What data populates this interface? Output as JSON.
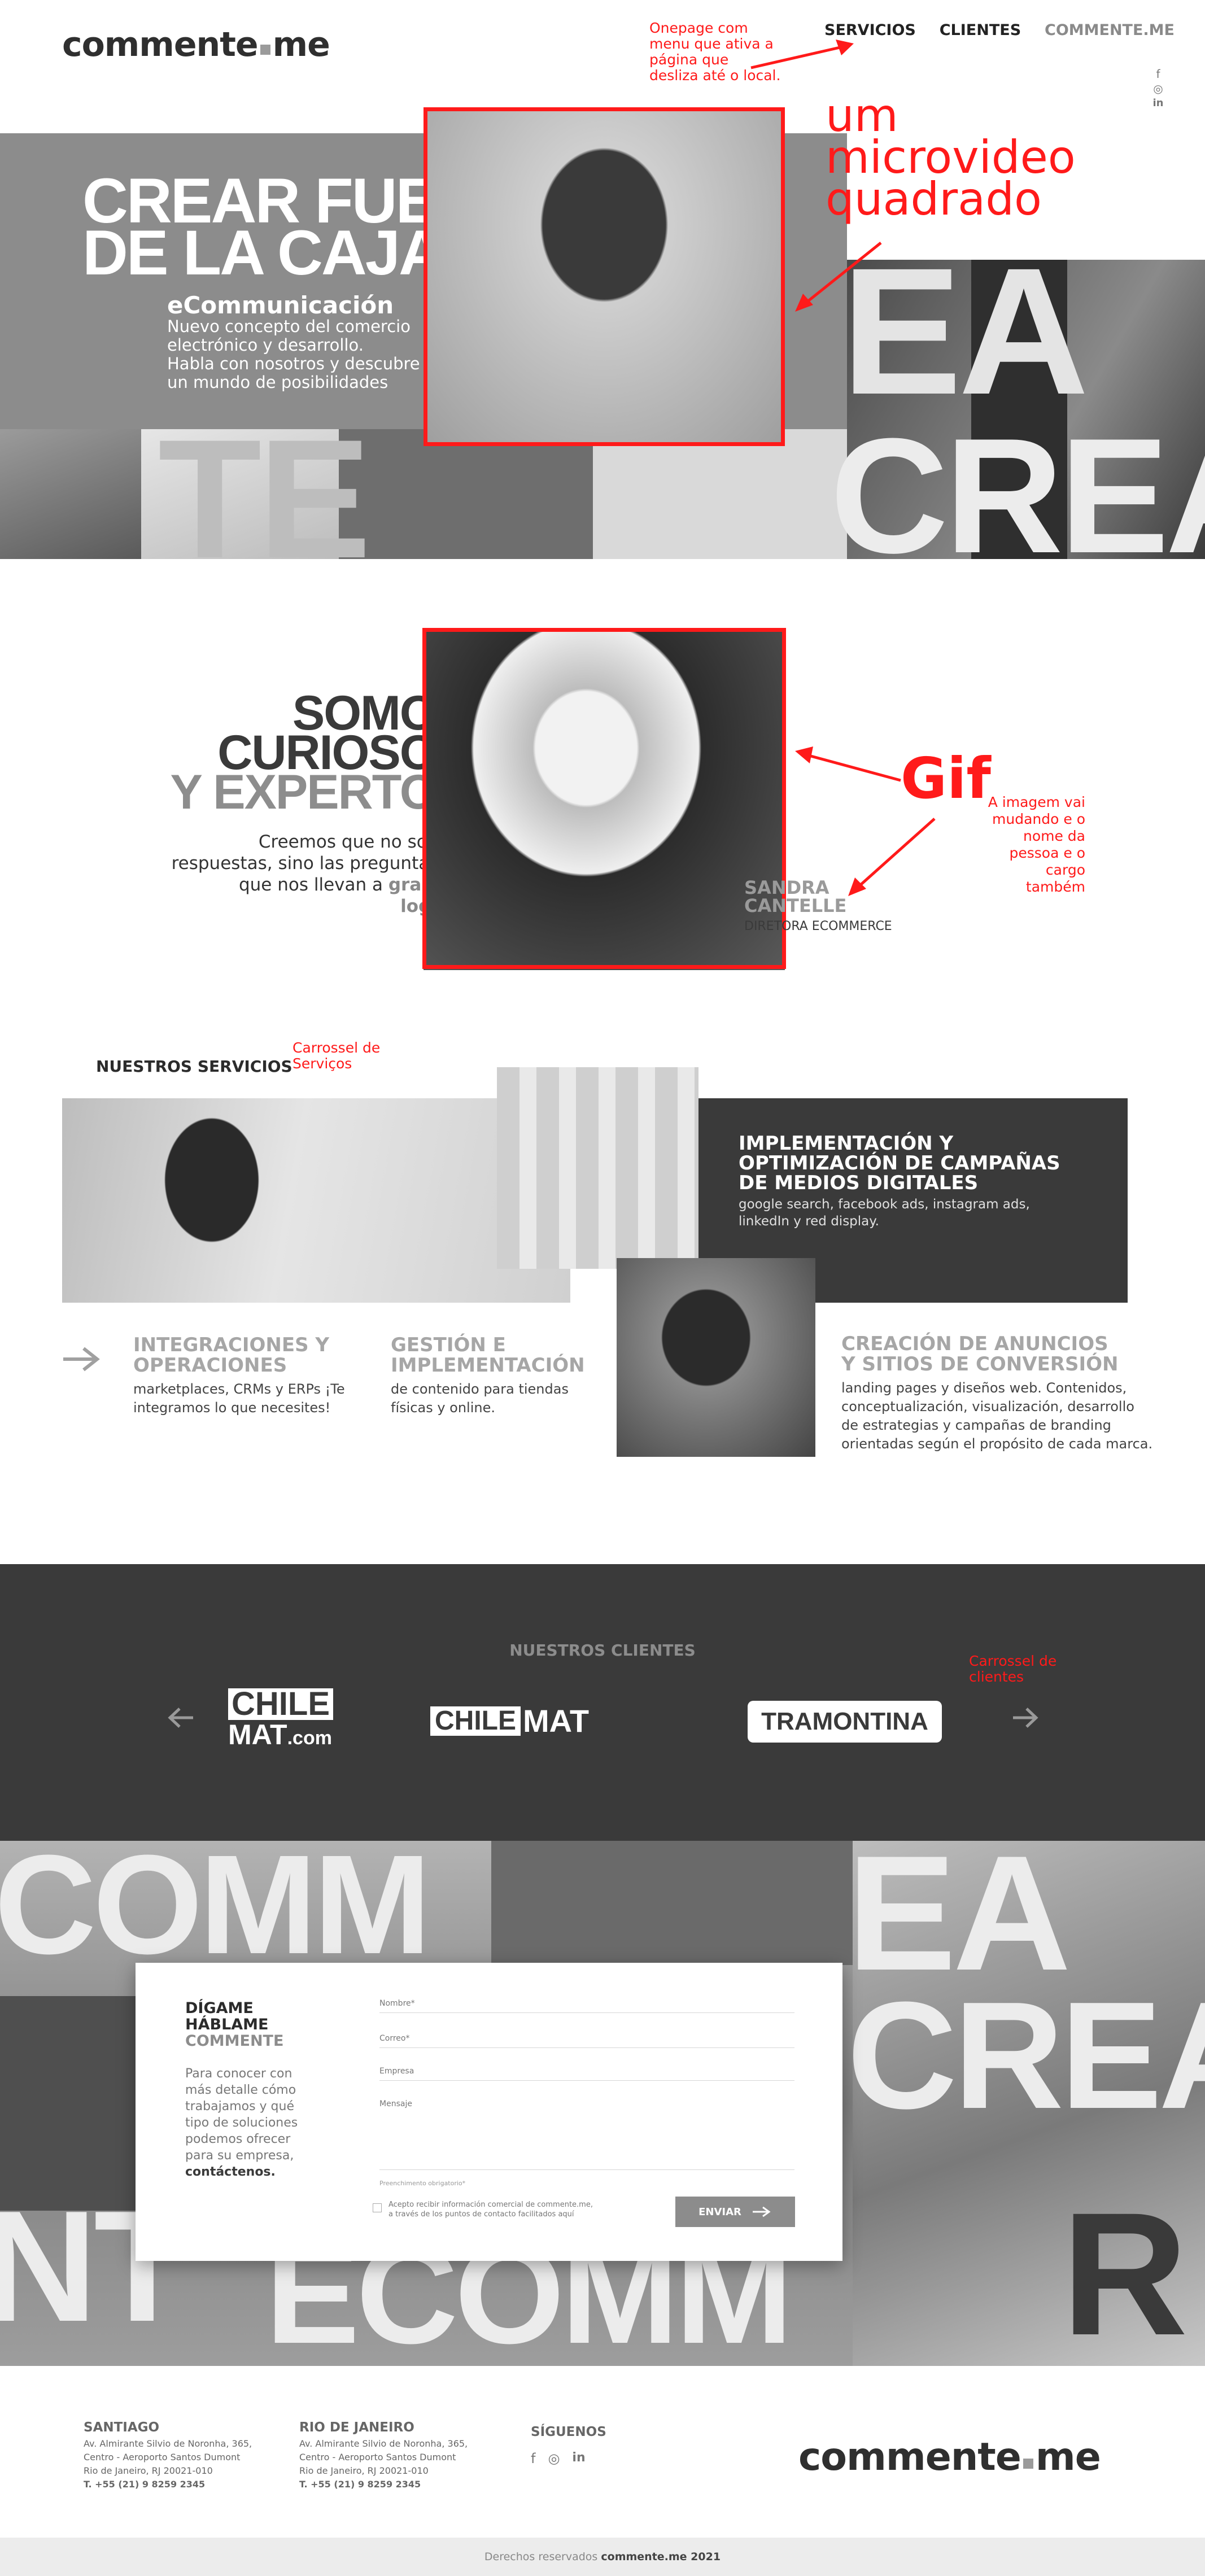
{
  "brand": {
    "name_left": "commente",
    "name_right": "me"
  },
  "nav": {
    "items": [
      "SERVICIOS",
      "CLIENTES",
      "COMMENTE.ME"
    ],
    "current_index": 2
  },
  "social_icons": [
    "facebook-icon",
    "instagram-icon",
    "linkedin-icon"
  ],
  "annotations": {
    "onepage": "Onepage com\nmenu que ativa a\npágina que\ndesliza até o local.",
    "microvideo": "um\nmicrovideo\nquadrado",
    "gif": "Gif",
    "gif_note": "A imagem vai\nmudando e o\nnome da\npessoa e o\ncargo\ntambém",
    "services_carousel": "Carrossel de\nServiços",
    "clients_carousel": "Carrossel de\nclientes"
  },
  "hero": {
    "title_line1": "CREAR FUERA",
    "title_line2": "DE LA CAJA",
    "subtitle": "eCommunicación",
    "text": "Nuevo concepto del comercio\nelectrónico y desarrollo.\nHabla con nosotros y descubre\nun mundo de posibilidades",
    "big_word_right": "EA",
    "big_word_crea": "CREA",
    "big_word_left": "TE"
  },
  "about": {
    "line1": "SOMOS",
    "line2": "CURIOSOS",
    "line3": "Y EXPERTOS",
    "text_before": "Creemos que no son las\nrespuestas, sino las preguntas las\nque nos llevan a ",
    "text_strong": "grandes logros.",
    "person_name": "SANDRA\nCANTELLE",
    "person_role": "DIRETORA ECOMMERCE"
  },
  "services": {
    "heading": "NUESTROS SERVICIOS",
    "featured": {
      "title": "IMPLEMENTACIÓN Y\nOPTIMIZACIÓN DE CAMPAÑAS\nDE MEDIOS DIGITALES",
      "text": "google search, facebook ads, instagram ads,\nlinkedIn y red display."
    },
    "items": [
      {
        "title": "INTEGRACIONES Y\nOPERACIONES",
        "text": "marketplaces, CRMs y ERPs ¡Te\nintegramos lo que necesites!"
      },
      {
        "title": "GESTIÓN E\nIMPLEMENTACIÓN",
        "text": "de contenido para tiendas\nfísicas y online."
      },
      {
        "title": "CREACIÓN DE ANUNCIOS\nY SITIOS DE CONVERSIÓN",
        "text": "landing pages y diseños web. Contenidos,\nconceptualización, visualización, desarrollo\nde estrategias y campañas de branding\norientadas según el propósito de cada marca."
      }
    ]
  },
  "clients": {
    "heading": "NUESTROS CLIENTES",
    "logo1_line1": "CHILE",
    "logo1_line2": "MAT",
    "logo1_suffix": ".com",
    "logo2_a": "CHILE",
    "logo2_b": "MAT",
    "logo3": "TRAMONTINA"
  },
  "contact": {
    "big_words": {
      "top": "COMM",
      "right_top": "EA",
      "right_mid": "CREA",
      "bottom_left": "NT",
      "bottom_mid": "ECOMM",
      "bottom_right": "R"
    },
    "title_line1": "DÍGAME",
    "title_line2": "HÁBLAME",
    "title_line3": "COMMENTE",
    "intro": "Para conocer con\nmás detalle cómo\ntrabajamos y qué\ntipo de soluciones\npodemos ofrecer\npara su empresa,",
    "intro_strong": "contáctenos.",
    "fields": {
      "name": "Nombre*",
      "email": "Correo*",
      "company": "Empresa",
      "message": "Mensaje"
    },
    "required_note": "Preenchimento obrigatorio*",
    "consent": "Acepto recibir información comercial de commente.me,\na través de los puntos de contacto facilitados aquí",
    "submit": "ENVIAR"
  },
  "footer": {
    "santiago_title": "SANTIAGO",
    "santiago_address": "Av. Almirante Silvio de Noronha, 365,\nCentro - Aeroporto Santos Dumont\nRio de Janeiro, RJ 20021-010",
    "santiago_phone": "T. +55 (21) 9 8259  2345",
    "rio_title": "RIO DE JANEIRO",
    "rio_address": "Av. Almirante Silvio de Noronha, 365,\nCentro - Aeroporto Santos Dumont\nRio de Janeiro, RJ 20021-010",
    "rio_phone": "T. +55 (21) 9 8259  2345",
    "follow": "SÍGUENOS",
    "copyright_prefix": "Derechos reservados ",
    "copyright_brand": "commente.me 2021"
  },
  "colors": {
    "accent_red": "#ff1a1a",
    "dark_band": "#3a3a3a",
    "hero_band": "#8c8c8c",
    "light_gray": "#ececec"
  }
}
